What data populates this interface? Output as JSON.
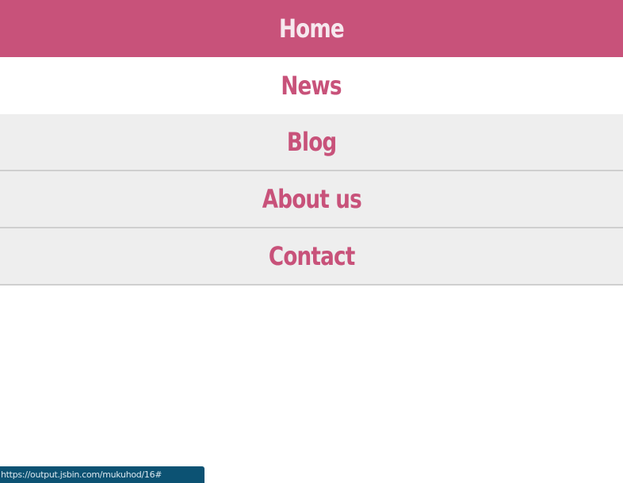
{
  "nav": {
    "items": [
      {
        "label": "Home",
        "state": "active"
      },
      {
        "label": "News",
        "state": "hovered"
      },
      {
        "label": "Blog",
        "state": "normal"
      },
      {
        "label": "About us",
        "state": "normal"
      },
      {
        "label": "Contact",
        "state": "normal"
      }
    ]
  },
  "status_bar": {
    "url": "https://output.jsbin.com/mukuhod/16#"
  },
  "colors": {
    "accent": "#c8527a",
    "item_background": "#eeeeee",
    "status_bar": "#0c5273"
  }
}
